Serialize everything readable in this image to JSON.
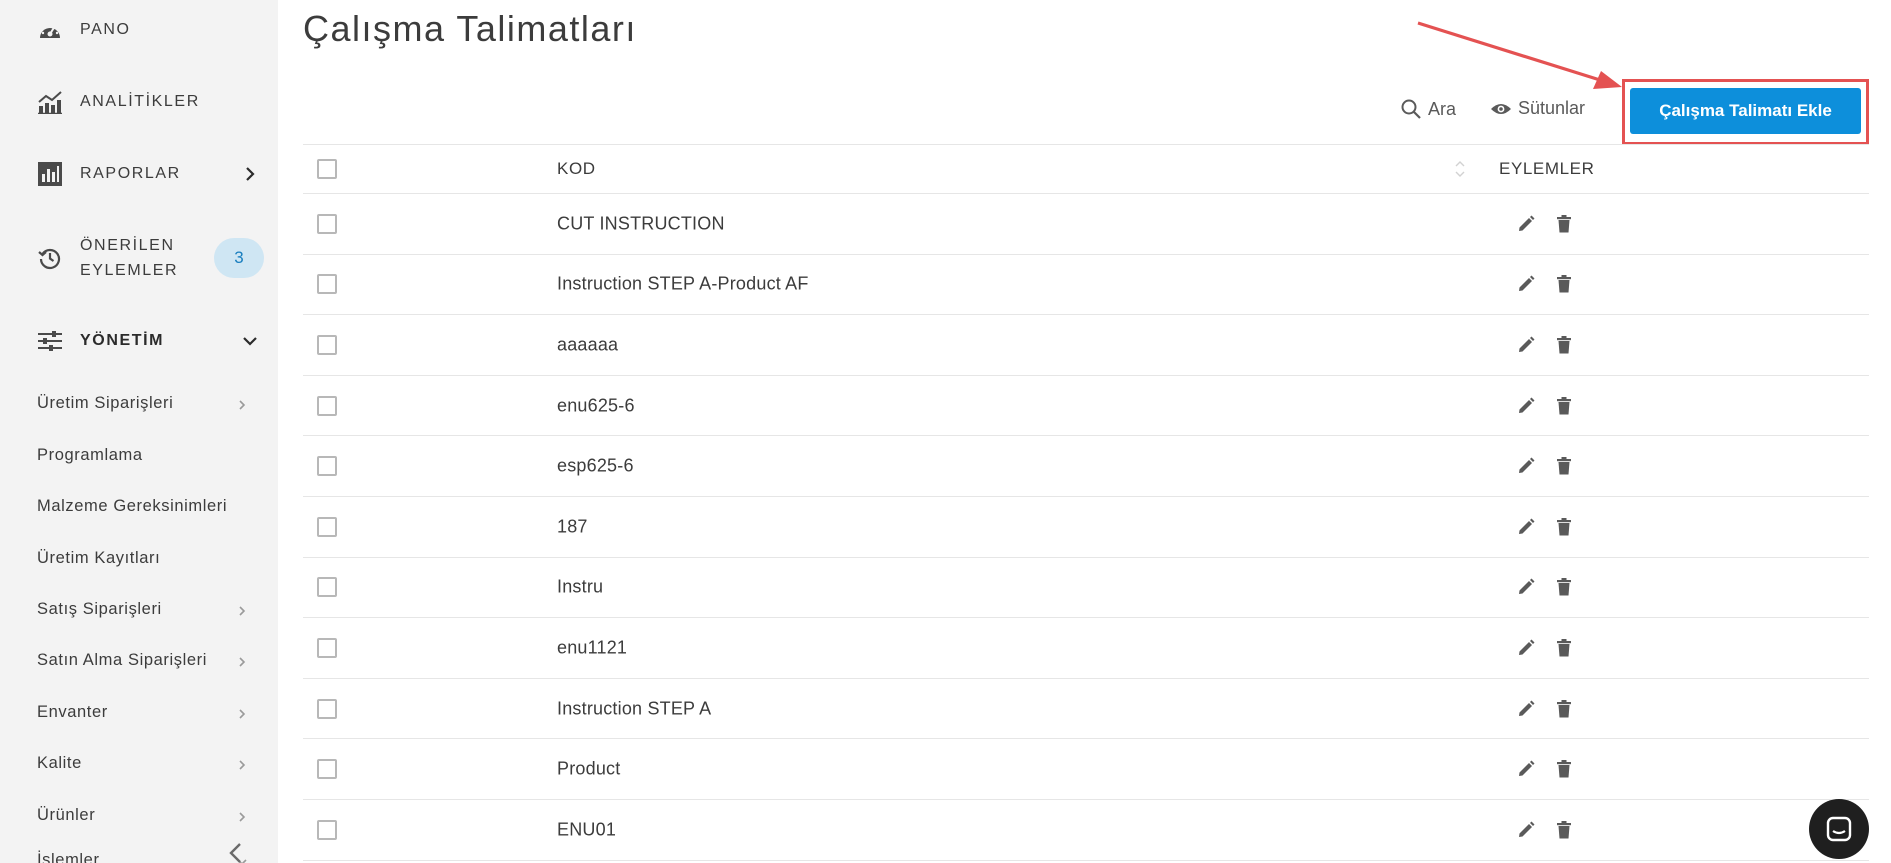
{
  "sidebar": {
    "main_items": [
      {
        "label": "PANO",
        "icon": "dashboard-gauge-icon"
      },
      {
        "label": "ANALİTİKLER",
        "icon": "analytics-chart-icon"
      },
      {
        "label": "RAPORLAR",
        "icon": "reports-icon"
      },
      {
        "label_line1": "ÖNERİLEN",
        "label_line2": "EYLEMLER",
        "icon": "history-icon",
        "badge": "3"
      },
      {
        "label": "YÖNETİM",
        "icon": "sliders-icon"
      }
    ],
    "sub_items": [
      {
        "label": "Üretim Siparişleri",
        "has_chevron": true
      },
      {
        "label": "Programlama",
        "has_chevron": false
      },
      {
        "label": "Malzeme Gereksinimleri",
        "has_chevron": false
      },
      {
        "label": "Üretim Kayıtları",
        "has_chevron": false
      },
      {
        "label": "Satış Siparişleri",
        "has_chevron": true
      },
      {
        "label": "Satın Alma Siparişleri",
        "has_chevron": true
      },
      {
        "label": "Envanter",
        "has_chevron": true
      },
      {
        "label": "Kalite",
        "has_chevron": true
      },
      {
        "label": "Ürünler",
        "has_chevron": true
      },
      {
        "label": "İşlemler",
        "has_chevron": true
      }
    ]
  },
  "page": {
    "title": "Çalışma Talimatları"
  },
  "toolbar": {
    "search_label": "Ara",
    "columns_label": "Sütunlar",
    "add_button_label": "Çalışma Talimatı Ekle"
  },
  "table": {
    "headers": {
      "code": "KOD",
      "actions": "EYLEMLER"
    },
    "rows": [
      "CUT INSTRUCTION",
      "Instruction STEP A-Product AF",
      "aaaaaa",
      "enu625-6",
      "esp625-6",
      "187",
      "Instru",
      "enu1121",
      "Instruction STEP A",
      "Product",
      "ENU01"
    ]
  },
  "colors": {
    "accent": "#0d8fdb",
    "highlight_border": "#e45252",
    "sidebar_bg": "#f3f3f3",
    "badge_bg": "#cfe6f3"
  }
}
